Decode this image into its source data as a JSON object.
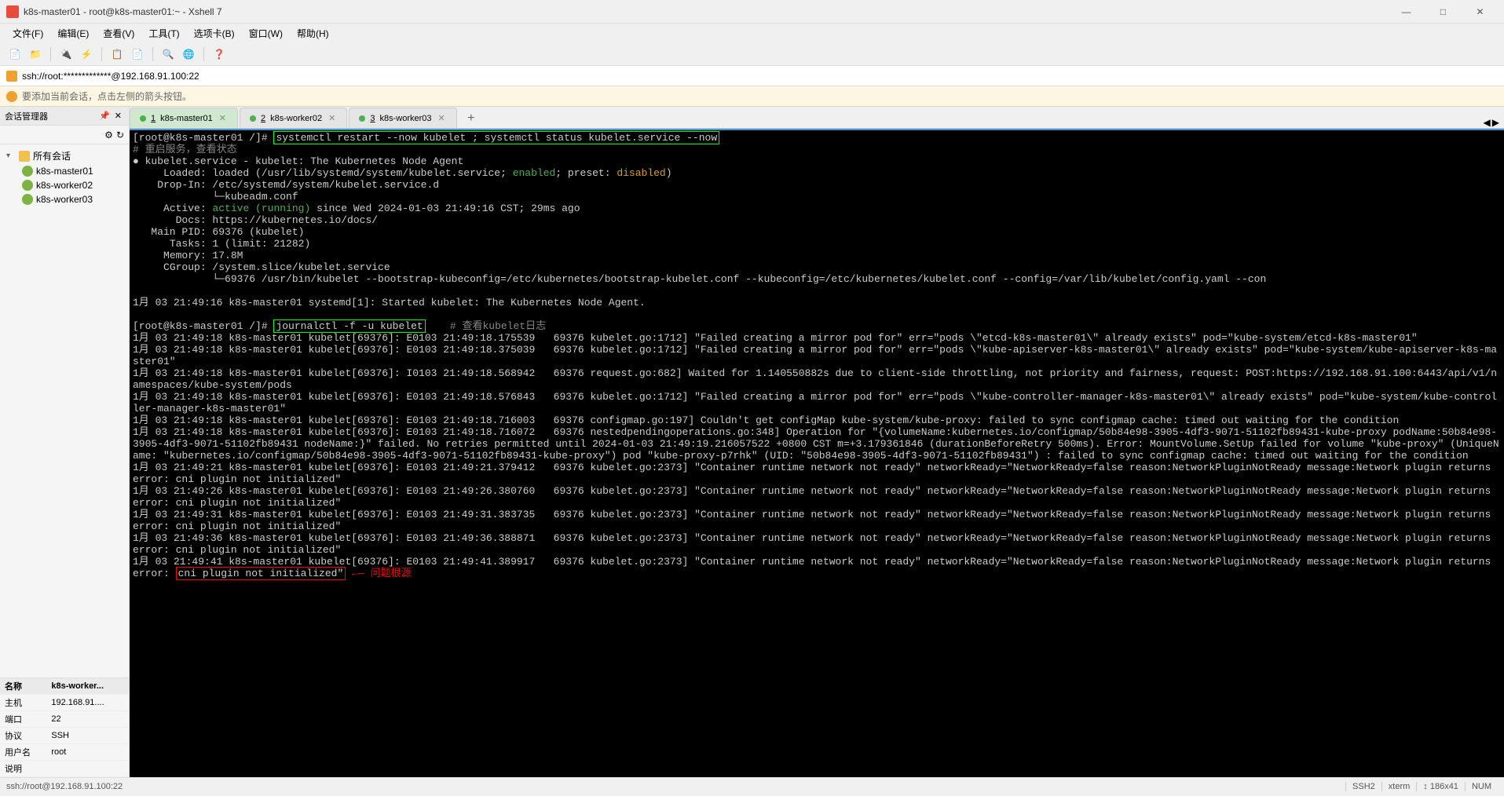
{
  "window": {
    "title": "k8s-master01 - root@k8s-master01:~ - Xshell 7"
  },
  "menu": {
    "file": "文件(F)",
    "edit": "编辑(E)",
    "view": "查看(V)",
    "tools": "工具(T)",
    "tabs": "选项卡(B)",
    "window": "窗口(W)",
    "help": "帮助(H)"
  },
  "addressbar": {
    "text": "ssh://root:*************@192.168.91.100:22"
  },
  "infobar": {
    "text": "要添加当前会话，点击左侧的箭头按钮。"
  },
  "sidebar": {
    "title": "会话管理器",
    "root": "所有会话",
    "hosts": [
      "k8s-master01",
      "k8s-worker02",
      "k8s-worker03"
    ]
  },
  "props": {
    "headers": [
      "名称",
      "k8s-worker..."
    ],
    "rows": [
      {
        "k": "主机",
        "v": "192.168.91...."
      },
      {
        "k": "端口",
        "v": "22"
      },
      {
        "k": "协议",
        "v": "SSH"
      },
      {
        "k": "用户名",
        "v": "root"
      },
      {
        "k": "说明",
        "v": ""
      }
    ]
  },
  "tabs": [
    {
      "num": "1",
      "label": "k8s-master01",
      "active": true
    },
    {
      "num": "2",
      "label": "k8s-worker02",
      "active": false
    },
    {
      "num": "3",
      "label": "k8s-worker03",
      "active": false
    }
  ],
  "term": {
    "prompt1": "[root@k8s-master01 /]# ",
    "cmd1": "systemctl restart --now kubelet ; systemctl status kubelet.service --now",
    "comment1": "# 重启服务，查看状态",
    "svc_line": "● kubelet.service - kubelet: The Kubernetes Node Agent",
    "loaded_prefix": "     Loaded: loaded (/usr/lib/systemd/system/kubelet.service; ",
    "enabled": "enabled",
    "loaded_mid": "; preset: ",
    "disabled": "disabled",
    "loaded_end": ")",
    "dropin1": "    Drop-In: /etc/systemd/system/kubelet.service.d",
    "dropin2": "             └─kubeadm.conf",
    "active_prefix": "     Active: ",
    "active_green": "active (running)",
    "active_suffix": " since Wed 2024-01-03 21:49:16 CST; 29ms ago",
    "docs": "       Docs: https://kubernetes.io/docs/",
    "mainpid": "   Main PID: 69376 (kubelet)",
    "tasks": "      Tasks: 1 (limit: 21282)",
    "memory": "     Memory: 17.8M",
    "cgroup": "     CGroup: /system.slice/kubelet.service",
    "cgroup2": "             └─69376 /usr/bin/kubelet --bootstrap-kubeconfig=/etc/kubernetes/bootstrap-kubelet.conf --kubeconfig=/etc/kubernetes/kubelet.conf --config=/var/lib/kubelet/config.yaml --con",
    "started": "1月 03 21:49:16 k8s-master01 systemd[1]: Started kubelet: The Kubernetes Node Agent.",
    "prompt2": "[root@k8s-master01 /]# ",
    "cmd2": "journalctl -f -u kubelet",
    "comment2": "    # 查看kubelet日志",
    "log1": "1月 03 21:49:18 k8s-master01 kubelet[69376]: E0103 21:49:18.175539   69376 kubelet.go:1712] \"Failed creating a mirror pod for\" err=\"pods \\\"etcd-k8s-master01\\\" already exists\" pod=\"kube-system/etcd-k8s-master01\"",
    "log2": "1月 03 21:49:18 k8s-master01 kubelet[69376]: E0103 21:49:18.375039   69376 kubelet.go:1712] \"Failed creating a mirror pod for\" err=\"pods \\\"kube-apiserver-k8s-master01\\\" already exists\" pod=\"kube-system/kube-apiserver-k8s-master01\"",
    "log3": "1月 03 21:49:18 k8s-master01 kubelet[69376]: I0103 21:49:18.568942   69376 request.go:682] Waited for 1.140550882s due to client-side throttling, not priority and fairness, request: POST:https://192.168.91.100:6443/api/v1/namespaces/kube-system/pods",
    "log4": "1月 03 21:49:18 k8s-master01 kubelet[69376]: E0103 21:49:18.576843   69376 kubelet.go:1712] \"Failed creating a mirror pod for\" err=\"pods \\\"kube-controller-manager-k8s-master01\\\" already exists\" pod=\"kube-system/kube-controller-manager-k8s-master01\"",
    "log5": "1月 03 21:49:18 k8s-master01 kubelet[69376]: E0103 21:49:18.716003   69376 configmap.go:197] Couldn't get configMap kube-system/kube-proxy: failed to sync configmap cache: timed out waiting for the condition",
    "log6": "1月 03 21:49:18 k8s-master01 kubelet[69376]: E0103 21:49:18.716072   69376 nestedpendingoperations.go:348] Operation for \"{volumeName:kubernetes.io/configmap/50b84e98-3905-4df3-9071-51102fb89431-kube-proxy podName:50b84e98-3905-4df3-9071-51102fb89431 nodeName:}\" failed. No retries permitted until 2024-01-03 21:49:19.216057522 +0800 CST m=+3.179361846 (durationBeforeRetry 500ms). Error: MountVolume.SetUp failed for volume \"kube-proxy\" (UniqueName: \"kubernetes.io/configmap/50b84e98-3905-4df3-9071-51102fb89431-kube-proxy\") pod \"kube-proxy-p7rhk\" (UID: \"50b84e98-3905-4df3-9071-51102fb89431\") : failed to sync configmap cache: timed out waiting for the condition",
    "log7": "1月 03 21:49:21 k8s-master01 kubelet[69376]: E0103 21:49:21.379412   69376 kubelet.go:2373] \"Container runtime network not ready\" networkReady=\"NetworkReady=false reason:NetworkPluginNotReady message:Network plugin returns error: cni plugin not initialized\"",
    "log8": "1月 03 21:49:26 k8s-master01 kubelet[69376]: E0103 21:49:26.380760   69376 kubelet.go:2373] \"Container runtime network not ready\" networkReady=\"NetworkReady=false reason:NetworkPluginNotReady message:Network plugin returns error: cni plugin not initialized\"",
    "log9": "1月 03 21:49:31 k8s-master01 kubelet[69376]: E0103 21:49:31.383735   69376 kubelet.go:2373] \"Container runtime network not ready\" networkReady=\"NetworkReady=false reason:NetworkPluginNotReady message:Network plugin returns error: cni plugin not initialized\"",
    "log10": "1月 03 21:49:36 k8s-master01 kubelet[69376]: E0103 21:49:36.388871   69376 kubelet.go:2373] \"Container runtime network not ready\" networkReady=\"NetworkReady=false reason:NetworkPluginNotReady message:Network plugin returns error: cni plugin not initialized\"",
    "log11_pre": "1月 03 21:49:41 k8s-master01 kubelet[69376]: E0103 21:49:41.389917   69376 kubelet.go:2373] \"Container runtime network not ready\" networkReady=\"NetworkReady=false reason:NetworkPluginNotReady message:Network plugin returns error: ",
    "log11_box": "cni plugin not initialized\"",
    "annotation_arrow": " ←— ",
    "annotation_text": "问题根源"
  },
  "status": {
    "left": "ssh://root@192.168.91.100:22",
    "ssh": "SSH2",
    "term": "xterm",
    "size": "↕ 186x41",
    "num": "NUM"
  }
}
